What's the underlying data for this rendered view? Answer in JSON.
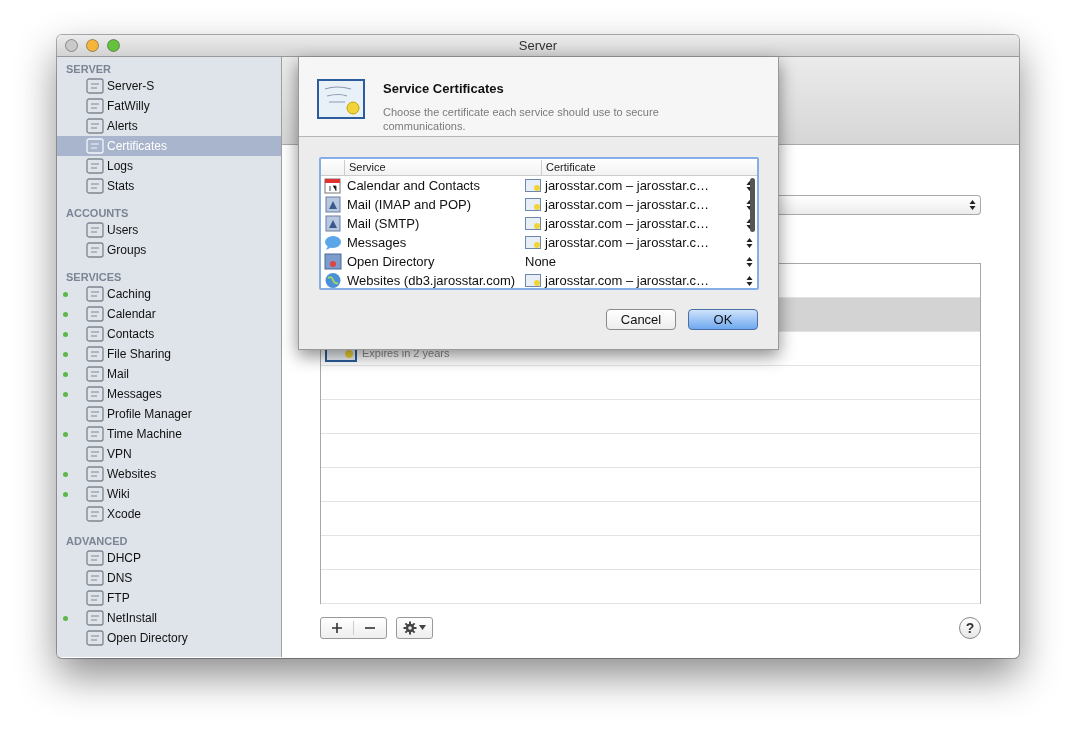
{
  "window": {
    "title": "Server"
  },
  "sidebar": {
    "sections": [
      {
        "title": "SERVER",
        "items": [
          {
            "label": "Server-S",
            "selected": false
          },
          {
            "label": "FatWilly",
            "selected": false
          },
          {
            "label": "Alerts",
            "selected": false
          },
          {
            "label": "Certificates",
            "selected": true
          },
          {
            "label": "Logs",
            "selected": false
          },
          {
            "label": "Stats",
            "selected": false
          }
        ]
      },
      {
        "title": "ACCOUNTS",
        "items": [
          {
            "label": "Users",
            "selected": false
          },
          {
            "label": "Groups",
            "selected": false
          }
        ]
      },
      {
        "title": "SERVICES",
        "items": [
          {
            "label": "Caching",
            "selected": false,
            "running": true
          },
          {
            "label": "Calendar",
            "selected": false,
            "running": true
          },
          {
            "label": "Contacts",
            "selected": false,
            "running": true
          },
          {
            "label": "File Sharing",
            "selected": false,
            "running": true
          },
          {
            "label": "Mail",
            "selected": false,
            "running": true
          },
          {
            "label": "Messages",
            "selected": false,
            "running": true
          },
          {
            "label": "Profile Manager",
            "selected": false,
            "running": false
          },
          {
            "label": "Time Machine",
            "selected": false,
            "running": true
          },
          {
            "label": "VPN",
            "selected": false,
            "running": false
          },
          {
            "label": "Websites",
            "selected": false,
            "running": true
          },
          {
            "label": "Wiki",
            "selected": false,
            "running": true
          },
          {
            "label": "Xcode",
            "selected": false,
            "running": false
          }
        ]
      },
      {
        "title": "ADVANCED",
        "items": [
          {
            "label": "DHCP",
            "selected": false,
            "running": false
          },
          {
            "label": "DNS",
            "selected": false,
            "running": false
          },
          {
            "label": "FTP",
            "selected": false,
            "running": false
          },
          {
            "label": "NetInstall",
            "selected": false,
            "running": true
          },
          {
            "label": "Open Directory",
            "selected": false,
            "running": false
          }
        ]
      }
    ]
  },
  "certificates": [
    {
      "selected": false
    },
    {
      "selected": true
    },
    {
      "selected": false,
      "detail": "Expires in 2 years"
    }
  ],
  "help": "?",
  "sheet": {
    "title": "Service Certificates",
    "description": "Choose the certificate each service should use to secure communications.",
    "columns": [
      "Service",
      "Certificate"
    ],
    "rows": [
      {
        "service": "Calendar and Contacts",
        "certificate": "jarosstar.com – jarosstar.c…",
        "kind": "certificate"
      },
      {
        "service": "Mail (IMAP and POP)",
        "certificate": "jarosstar.com – jarosstar.c…",
        "kind": "certificate"
      },
      {
        "service": "Mail (SMTP)",
        "certificate": "jarosstar.com – jarosstar.c…",
        "kind": "certificate"
      },
      {
        "service": "Messages",
        "certificate": "jarosstar.com – jarosstar.c…",
        "kind": "certificate"
      },
      {
        "service": "Open Directory",
        "certificate": "None",
        "kind": "none"
      },
      {
        "service": "Websites (db3.jarosstar.com)",
        "certificate": "jarosstar.com – jarosstar.c…",
        "kind": "certificate"
      }
    ],
    "buttons": [
      {
        "label": "Cancel",
        "default": false
      },
      {
        "label": "OK",
        "default": true
      }
    ]
  }
}
